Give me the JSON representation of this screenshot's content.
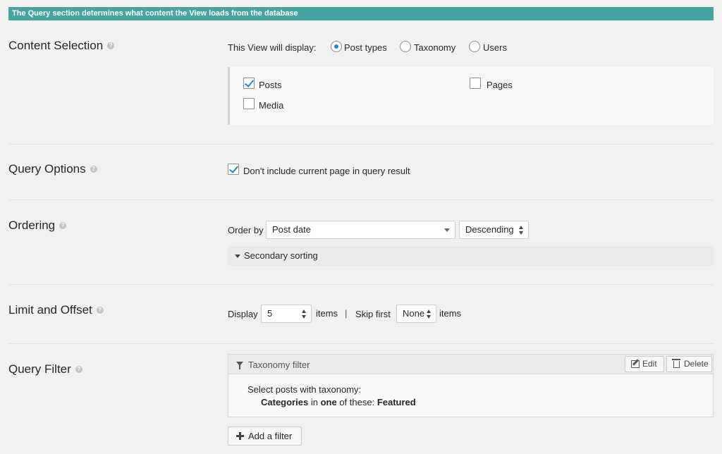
{
  "banner": "The Query section determines what content the View loads from the database",
  "content_selection": {
    "title": "Content Selection",
    "display_label": "This View will display:",
    "options": [
      "Post types",
      "Taxonomy",
      "Users"
    ],
    "selected": "Post types",
    "post_types": [
      {
        "label": "Posts",
        "checked": true
      },
      {
        "label": "Pages",
        "checked": false
      },
      {
        "label": "Media",
        "checked": false
      }
    ]
  },
  "query_options": {
    "title": "Query Options",
    "exclude_current_label": "Don't include current page in query result",
    "exclude_current_checked": true
  },
  "ordering": {
    "title": "Ordering",
    "order_by_label": "Order by",
    "order_by_value": "Post date",
    "direction_value": "Descending",
    "secondary_label": "Secondary sorting"
  },
  "limit_offset": {
    "title": "Limit and Offset",
    "display_label": "Display",
    "display_value": "5",
    "items_label": "items",
    "divider": "|",
    "skip_label": "Skip first",
    "skip_value": "None",
    "items_label_2": "items"
  },
  "query_filter": {
    "title": "Query Filter",
    "filter_title": "Taxonomy filter",
    "edit_label": "Edit",
    "delete_label": "Delete",
    "line1": "Select posts with taxonomy:",
    "line2_taxonomy": "Categories",
    "line2_in": "in",
    "line2_mode": "one",
    "line2_of": "of these:",
    "line2_term": "Featured",
    "add_label": "Add a filter"
  },
  "colors": {
    "banner_bg": "#46a5a2",
    "accent": "#1e8cbe"
  }
}
